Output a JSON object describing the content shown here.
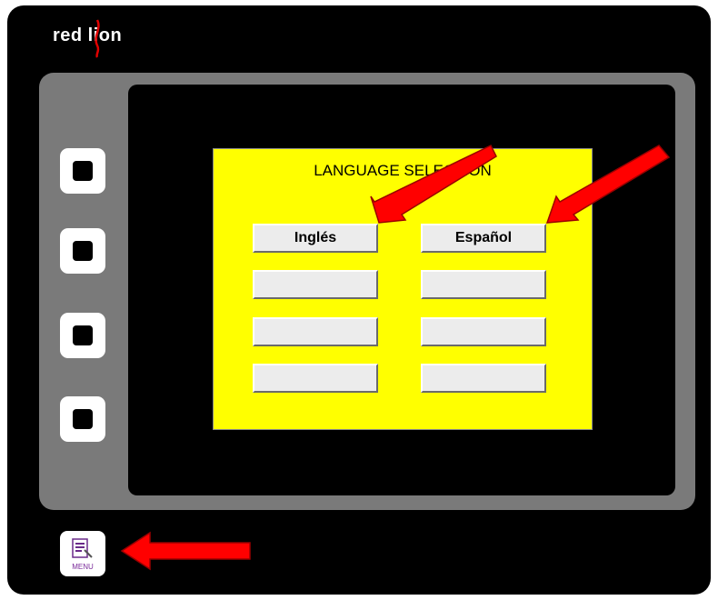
{
  "device": {
    "brand": "red lion"
  },
  "screen": {
    "title": "LANGUAGE SELECTION",
    "language_buttons": [
      {
        "label": "Inglés"
      },
      {
        "label": "Español"
      },
      {
        "label": ""
      },
      {
        "label": ""
      },
      {
        "label": ""
      },
      {
        "label": ""
      },
      {
        "label": ""
      },
      {
        "label": ""
      }
    ]
  },
  "menu_button": {
    "label": "MENU",
    "icon": "menu-document-icon"
  },
  "colors": {
    "panel": "#ffff00",
    "bezel": "#7a7a7a",
    "annotation_arrow": "#ff0000",
    "logo_accent": "#e00000"
  }
}
